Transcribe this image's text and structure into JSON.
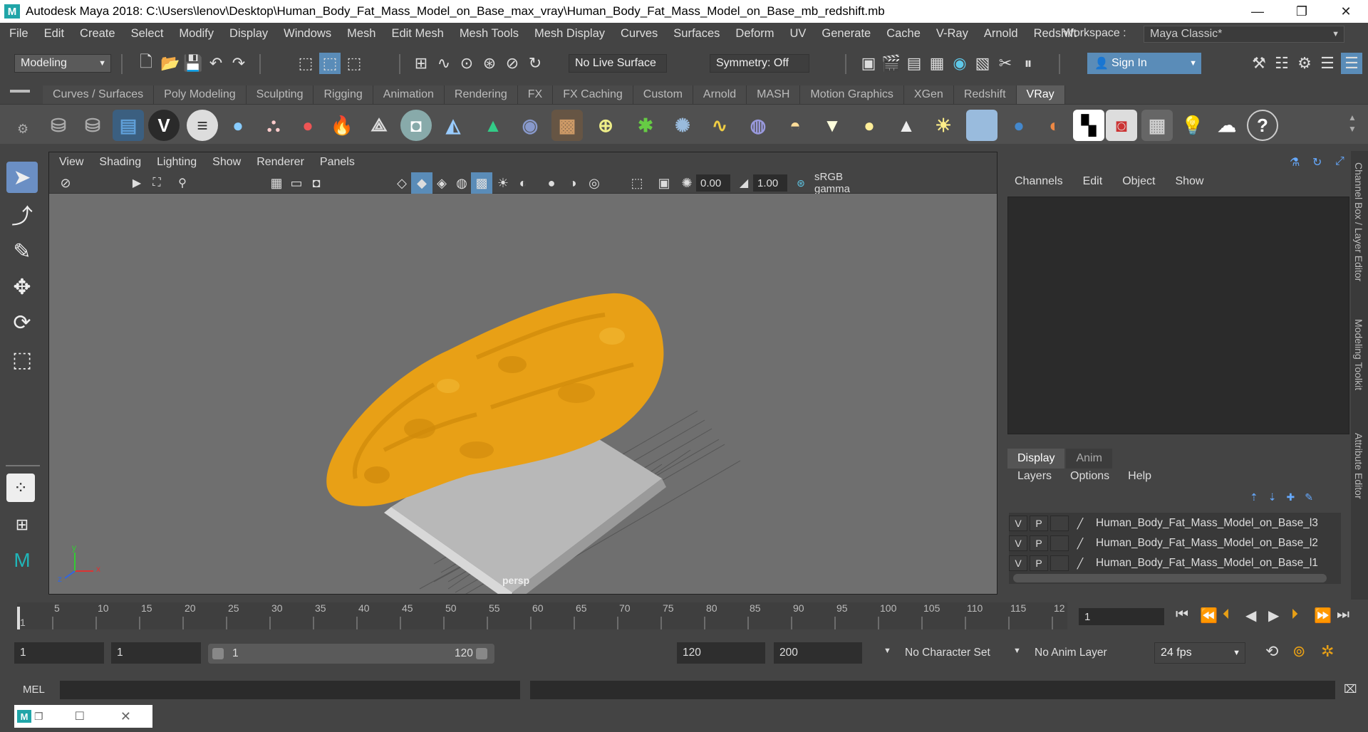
{
  "app": {
    "title": "Autodesk Maya 2018: C:\\Users\\lenov\\Desktop\\Human_Body_Fat_Mass_Model_on_Base_max_vray\\Human_Body_Fat_Mass_Model_on_Base_mb_redshift.mb",
    "logo_letter": "M"
  },
  "window_controls": {
    "minimize": "—",
    "maximize": "❐",
    "close": "✕"
  },
  "menubar": [
    "File",
    "Edit",
    "Create",
    "Select",
    "Modify",
    "Display",
    "Windows",
    "Mesh",
    "Edit Mesh",
    "Mesh Tools",
    "Mesh Display",
    "Curves",
    "Surfaces",
    "Deform",
    "UV",
    "Generate",
    "Cache",
    "V-Ray",
    "Arnold",
    "Redshift"
  ],
  "workspace": {
    "label": "Workspace :",
    "value": "Maya Classic*"
  },
  "toolbar": {
    "mode": "Modeling",
    "live_surface": "No Live Surface",
    "symmetry": "Symmetry: Off",
    "sign_in": "Sign In"
  },
  "shelf_tabs": [
    "Curves / Surfaces",
    "Poly Modeling",
    "Sculpting",
    "Rigging",
    "Animation",
    "Rendering",
    "FX",
    "FX Caching",
    "Custom",
    "Arnold",
    "MASH",
    "Motion Graphics",
    "XGen",
    "Redshift",
    "VRay"
  ],
  "shelf_active": "VRay",
  "viewport": {
    "menu": [
      "View",
      "Shading",
      "Lighting",
      "Show",
      "Renderer",
      "Panels"
    ],
    "exposure": "0.00",
    "gamma": "1.00",
    "color_space": "sRGB gamma",
    "camera_label": "persp",
    "axis_x": "x",
    "axis_y": "y",
    "axis_z": "z"
  },
  "channel_box": {
    "menu": [
      "Channels",
      "Edit",
      "Object",
      "Show"
    ]
  },
  "layer_editor": {
    "tabs": [
      "Display",
      "Anim"
    ],
    "active_tab": "Display",
    "menu": [
      "Layers",
      "Options",
      "Help"
    ],
    "layers": [
      {
        "v": "V",
        "p": "P",
        "name": "Human_Body_Fat_Mass_Model_on_Base_l3"
      },
      {
        "v": "V",
        "p": "P",
        "name": "Human_Body_Fat_Mass_Model_on_Base_l2"
      },
      {
        "v": "V",
        "p": "P",
        "name": "Human_Body_Fat_Mass_Model_on_Base_l1"
      }
    ]
  },
  "side_tabs": [
    "Channel Box / Layer Editor",
    "Modeling Toolkit",
    "Attribute Editor"
  ],
  "timeline": {
    "ticks": [
      "1",
      "5",
      "10",
      "15",
      "20",
      "25",
      "30",
      "35",
      "40",
      "45",
      "50",
      "55",
      "60",
      "65",
      "70",
      "75",
      "80",
      "85",
      "90",
      "95",
      "100",
      "105",
      "110",
      "115",
      "12"
    ],
    "current_frame": "1"
  },
  "range": {
    "start": "1",
    "playback_start": "1",
    "slider_start": "1",
    "slider_end": "120",
    "playback_end": "120",
    "end": "200",
    "character_set": "No Character Set",
    "anim_layer": "No Anim Layer",
    "fps": "24 fps"
  },
  "command_line": {
    "label": "MEL"
  },
  "colors": {
    "fat_mass": "#e8a016",
    "base": "#d9d9d9",
    "accent": "#5a8cb8"
  }
}
